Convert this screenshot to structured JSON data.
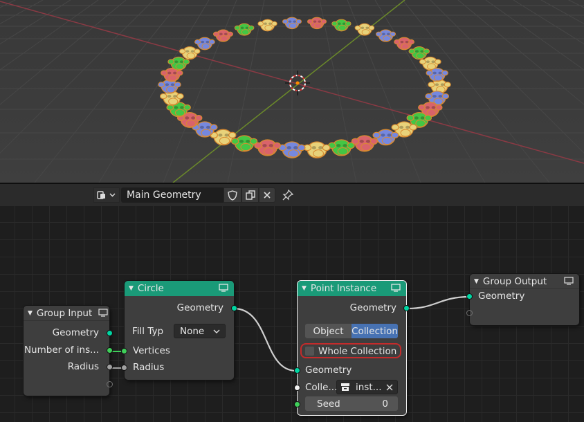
{
  "editor_header": {
    "node_tree_name": "Main Geometry"
  },
  "nodes": {
    "group_input": {
      "title": "Group Input",
      "outputs": [
        "Geometry",
        "Number of ins...",
        "Radius"
      ]
    },
    "circle": {
      "title": "Circle",
      "output": "Geometry",
      "fill_type_label": "Fill Typ",
      "fill_type_value": "None",
      "inputs": [
        "Vertices",
        "Radius"
      ]
    },
    "point_instance": {
      "title": "Point Instance",
      "output": "Geometry",
      "mode_options": [
        "Object",
        "Collection"
      ],
      "mode_selected": "Collection",
      "whole_collection_label": "Whole Collection",
      "input_geometry": "Geometry",
      "collection_label": "Colle...",
      "collection_value": "inst...",
      "seed_label": "Seed",
      "seed_value": "0"
    },
    "group_output": {
      "title": "Group Output",
      "input": "Geometry"
    }
  },
  "colors": {
    "geometry_header": "#1a9a78",
    "geometry_socket": "#00d6a3",
    "float_socket": "#a1a1a1",
    "int_socket": "#3fcf5a",
    "highlight": "#c42b2b",
    "selected_option": "#4772b3"
  }
}
